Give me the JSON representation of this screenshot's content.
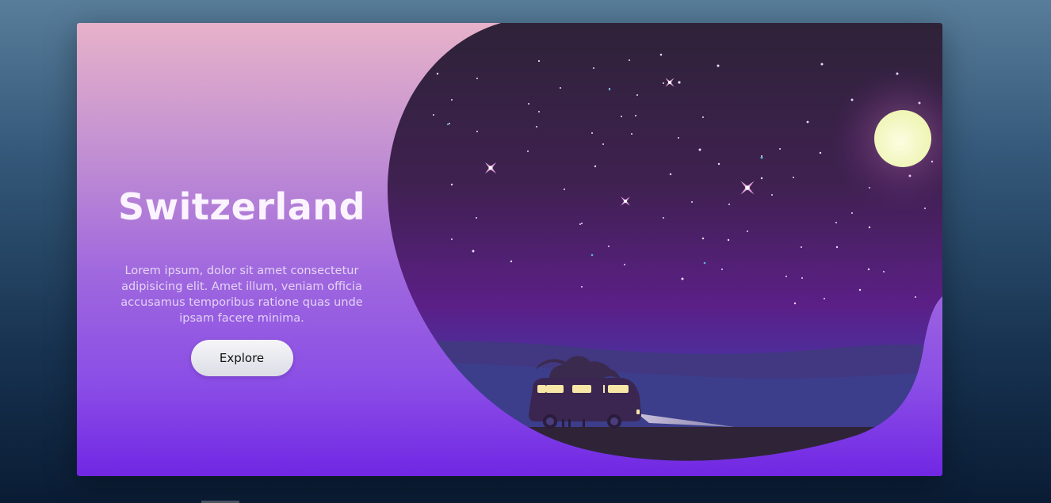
{
  "hero": {
    "title": "Switzerland",
    "description": "Lorem ipsum, dolor sit amet consectetur adipisicing elit. Amet illum, veniam officia accusamus temporibus ratione quas unde ipsam facere minima.",
    "button_label": "Explore"
  },
  "colors": {
    "card_top": "#e7b2c9",
    "card_bottom": "#7127e3",
    "night_sky_top": "#2e2238",
    "night_sky_bottom": "#5b1f86",
    "moon": "#f6f9c8"
  },
  "scene": {
    "icons": [
      "night-sky",
      "stars",
      "moon",
      "hills",
      "camper-van",
      "palm-trees",
      "headlight-beam"
    ]
  }
}
